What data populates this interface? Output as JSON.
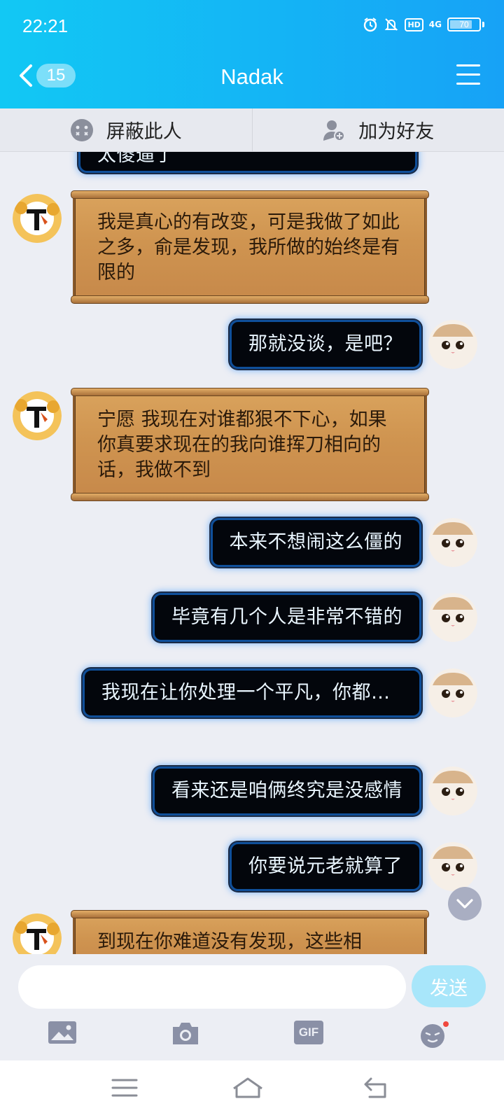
{
  "status_bar": {
    "time": "22:21",
    "hd_label": "HD",
    "network_label": "4G",
    "battery_level": "70",
    "icons": [
      "alarm-icon",
      "mute-icon",
      "hd-icon",
      "signal-4g-icon",
      "battery-icon"
    ]
  },
  "header": {
    "unread_count": "15",
    "title": "Nadak",
    "colors": {
      "header_from": "#12c8f4",
      "header_to": "#17a2f6"
    }
  },
  "actions": {
    "block_label": "屏蔽此人",
    "add_friend_label": "加为好友"
  },
  "messages": [
    {
      "side": "received",
      "text": "太傻逼了",
      "partial": true
    },
    {
      "side": "received",
      "text": "我是真心的有改变，可是我做了如此之多，俞是发现，我所做的始终是有限的"
    },
    {
      "side": "sent",
      "text": "那就没谈，是吧？"
    },
    {
      "side": "received",
      "text": "宁愿  我现在对谁都狠不下心，如果你真要求现在的我向谁挥刀相向的话，我做不到"
    },
    {
      "side": "sent",
      "text": "本来不想闹这么僵的"
    },
    {
      "side": "sent",
      "text": "毕竟有几个人是非常不错的"
    },
    {
      "side": "sent",
      "text": "我现在让你处理一个平凡，你都…"
    },
    {
      "side": "sent",
      "text": "看来还是咱俩终究是没感情"
    },
    {
      "side": "sent",
      "text": "你要说元老就算了"
    },
    {
      "side": "received",
      "text": "到现在你难道没有发现，这些相",
      "partial": true
    }
  ],
  "input": {
    "placeholder": "",
    "send_label": "发送",
    "gif_label": "GIF",
    "send_color": "#a8e6fa"
  },
  "toolbar_icons": [
    "image-icon",
    "camera-icon",
    "gif-icon",
    "emoji-icon"
  ],
  "nav_icons": [
    "menu-icon",
    "home-icon",
    "back-icon"
  ]
}
